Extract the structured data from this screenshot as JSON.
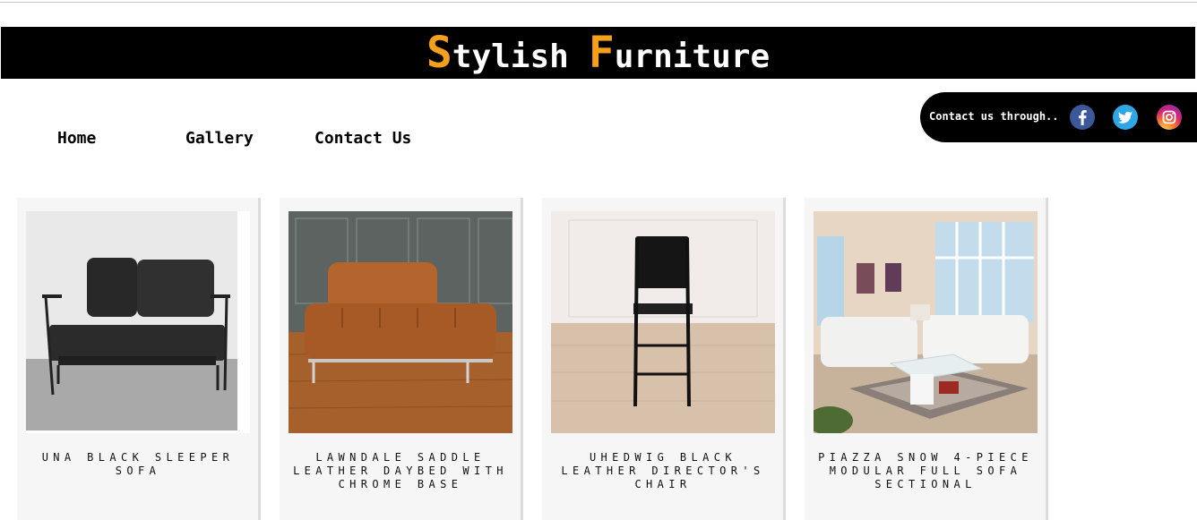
{
  "header": {
    "brand": [
      {
        "cap": "S",
        "rest": "tylish"
      },
      {
        "cap": "F",
        "rest": "urniture"
      }
    ],
    "accent_color": "#f5a01a"
  },
  "nav": {
    "items": [
      {
        "label": "Home"
      },
      {
        "label": "Gallery"
      },
      {
        "label": "Contact Us"
      }
    ]
  },
  "contact": {
    "label": "Contact us through..",
    "icons": [
      "facebook-icon",
      "twitter-icon",
      "instagram-icon"
    ]
  },
  "products": [
    {
      "title": "Una Black Sleeper Sofa"
    },
    {
      "title": "Lawndale Saddle Leather Daybed with Chrome Base"
    },
    {
      "title": "Uhedwig Black Leather Director's Chair"
    },
    {
      "title": "Piazza Snow 4-Piece Modular Full Sofa Sectional"
    }
  ]
}
